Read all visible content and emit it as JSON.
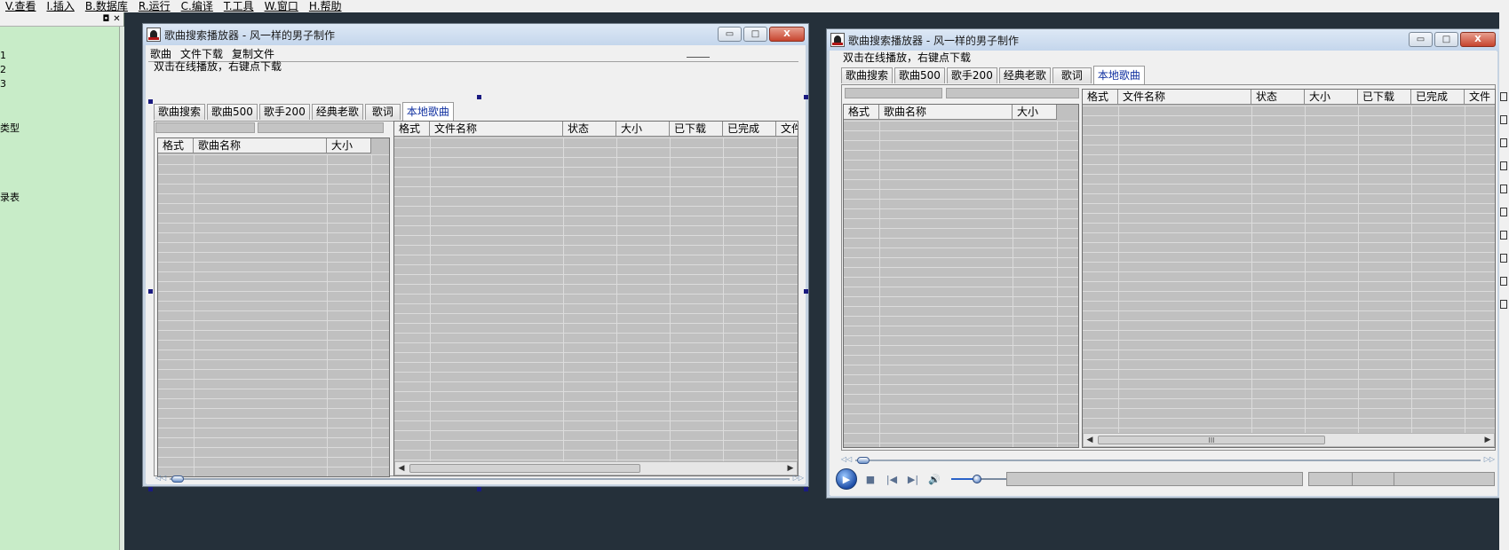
{
  "ide": {
    "menu": [
      "V.查看",
      "I.插入",
      "B.数据库",
      "R.运行",
      "C.编译",
      "T.工具",
      "W.窗口",
      "H.帮助"
    ],
    "left_panel": {
      "items": [
        "1",
        "2",
        "3",
        "类型",
        "录表"
      ]
    }
  },
  "window_design": {
    "title": "歌曲搜索播放器 - 风一样的男子制作",
    "menu": [
      "歌曲",
      "文件下载",
      "复制文件"
    ],
    "hint": "双击在线播放，右键点下载",
    "tabs": [
      "歌曲搜索",
      "歌曲500",
      "歌手200",
      "经典老歌",
      "歌词",
      "本地歌曲"
    ],
    "active_tab": "本地歌曲",
    "left_grid_columns": [
      "格式",
      "歌曲名称",
      "大小"
    ],
    "right_grid_columns": [
      "格式",
      "文件名称",
      "状态",
      "大小",
      "已下载",
      "已完成",
      "文件"
    ]
  },
  "window_run": {
    "title": "歌曲搜索播放器 - 风一样的男子制作",
    "hint": "双击在线播放，右键点下载",
    "tabs": [
      "歌曲搜索",
      "歌曲500",
      "歌手200",
      "经典老歌",
      "歌词",
      "本地歌曲"
    ],
    "active_tab": "本地歌曲",
    "left_grid_columns": [
      "格式",
      "歌曲名称",
      "大小"
    ],
    "right_grid_columns": [
      "格式",
      "文件名称",
      "状态",
      "大小",
      "已下载",
      "已完成",
      "文件"
    ],
    "hscroll_grip": "III",
    "volume_fraction": 0.45
  },
  "window_buttons": {
    "minimize": "▭",
    "maximize": "□",
    "close": "X"
  },
  "colors": {
    "left_panel_bg": "#c8ecc8",
    "work_area_bg": "#25303a",
    "grid_bg": "#c0c0c0",
    "active_tab_text": "#1030a0"
  }
}
